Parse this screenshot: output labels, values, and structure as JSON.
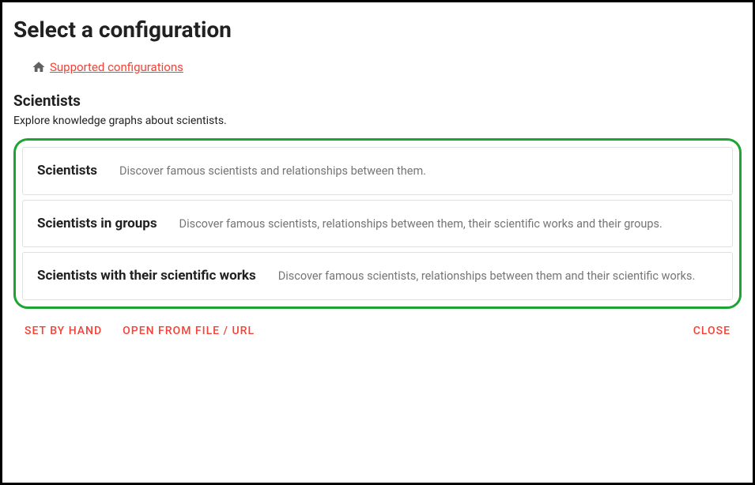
{
  "dialog": {
    "title": "Select a configuration"
  },
  "breadcrumb": {
    "home_icon": "home-icon",
    "link_label": "Supported configurations"
  },
  "section": {
    "title": "Scientists",
    "description": "Explore knowledge graphs about scientists."
  },
  "configs": [
    {
      "title": "Scientists",
      "description": "Discover famous scientists and relationships between them."
    },
    {
      "title": "Scientists in groups",
      "description": "Discover famous scientists, relationships between them, their scientific works and their groups."
    },
    {
      "title": "Scientists with their scientific works",
      "description": "Discover famous scientists, relationships between them and their scientific works."
    }
  ],
  "actions": {
    "set_by_hand": "SET BY HAND",
    "open_from_file": "OPEN FROM FILE / URL",
    "close": "CLOSE"
  },
  "colors": {
    "accent": "#f44336",
    "frame": "#1da432"
  }
}
